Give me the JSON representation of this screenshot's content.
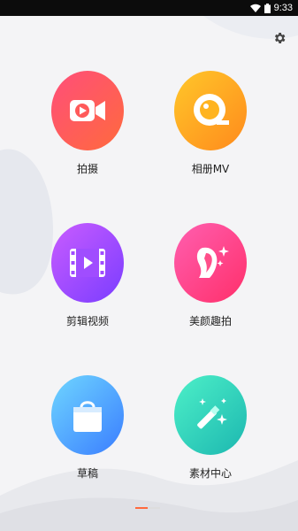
{
  "status_bar": {
    "time": "9:33"
  },
  "tiles": [
    {
      "label": "拍摄",
      "icon": "video-camera-icon",
      "gradient": [
        "#ff4e7a",
        "#ff6a3d"
      ]
    },
    {
      "label": "相册MV",
      "icon": "album-lens-icon",
      "gradient": [
        "#ffc72a",
        "#ff8a1c"
      ]
    },
    {
      "label": "剪辑视频",
      "icon": "film-strip-icon",
      "gradient": [
        "#c95cff",
        "#7a3dff"
      ]
    },
    {
      "label": "美颜趣拍",
      "icon": "face-sparkle-icon",
      "gradient": [
        "#ff5fb0",
        "#ff2f6a"
      ]
    },
    {
      "label": "草稿",
      "icon": "shopping-bag-icon",
      "gradient": [
        "#6fd6ff",
        "#3a7dff"
      ]
    },
    {
      "label": "素材中心",
      "icon": "magic-wand-icon",
      "gradient": [
        "#4df0c8",
        "#1cb7b0"
      ]
    }
  ],
  "colors": {
    "background": "#f4f4f6",
    "pager_active": "#ff6a3d",
    "pager_inactive": "#dddddd"
  }
}
